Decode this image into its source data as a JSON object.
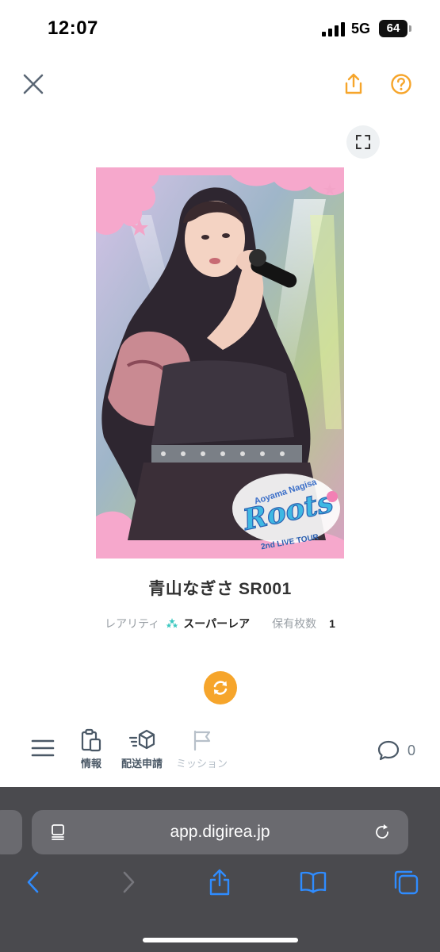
{
  "status": {
    "time": "12:07",
    "network": "5G",
    "battery": "64"
  },
  "card": {
    "title": "青山なぎさ SR001",
    "logo_text": {
      "name": "Aoyama Nagisa",
      "series": "Roots",
      "tour": "2nd LIVE TOUR"
    }
  },
  "meta": {
    "rarity_label": "レアリティ",
    "rarity_value": "スーパーレア",
    "owned_label": "保有枚数",
    "owned_value": "1"
  },
  "toolbar": {
    "info_label": "情報",
    "shipping_label": "配送申請",
    "mission_label": "ミッション",
    "comment_count": "0"
  },
  "browser": {
    "url": "app.digirea.jp"
  },
  "colors": {
    "accent": "#f6a52b",
    "toolbar_icon": "#4a5866",
    "disabled": "#b7c0c9",
    "safari_bg": "#4a4a4e",
    "safari_blue": "#2f8cff",
    "rarity_star": "#3cc8c0"
  }
}
